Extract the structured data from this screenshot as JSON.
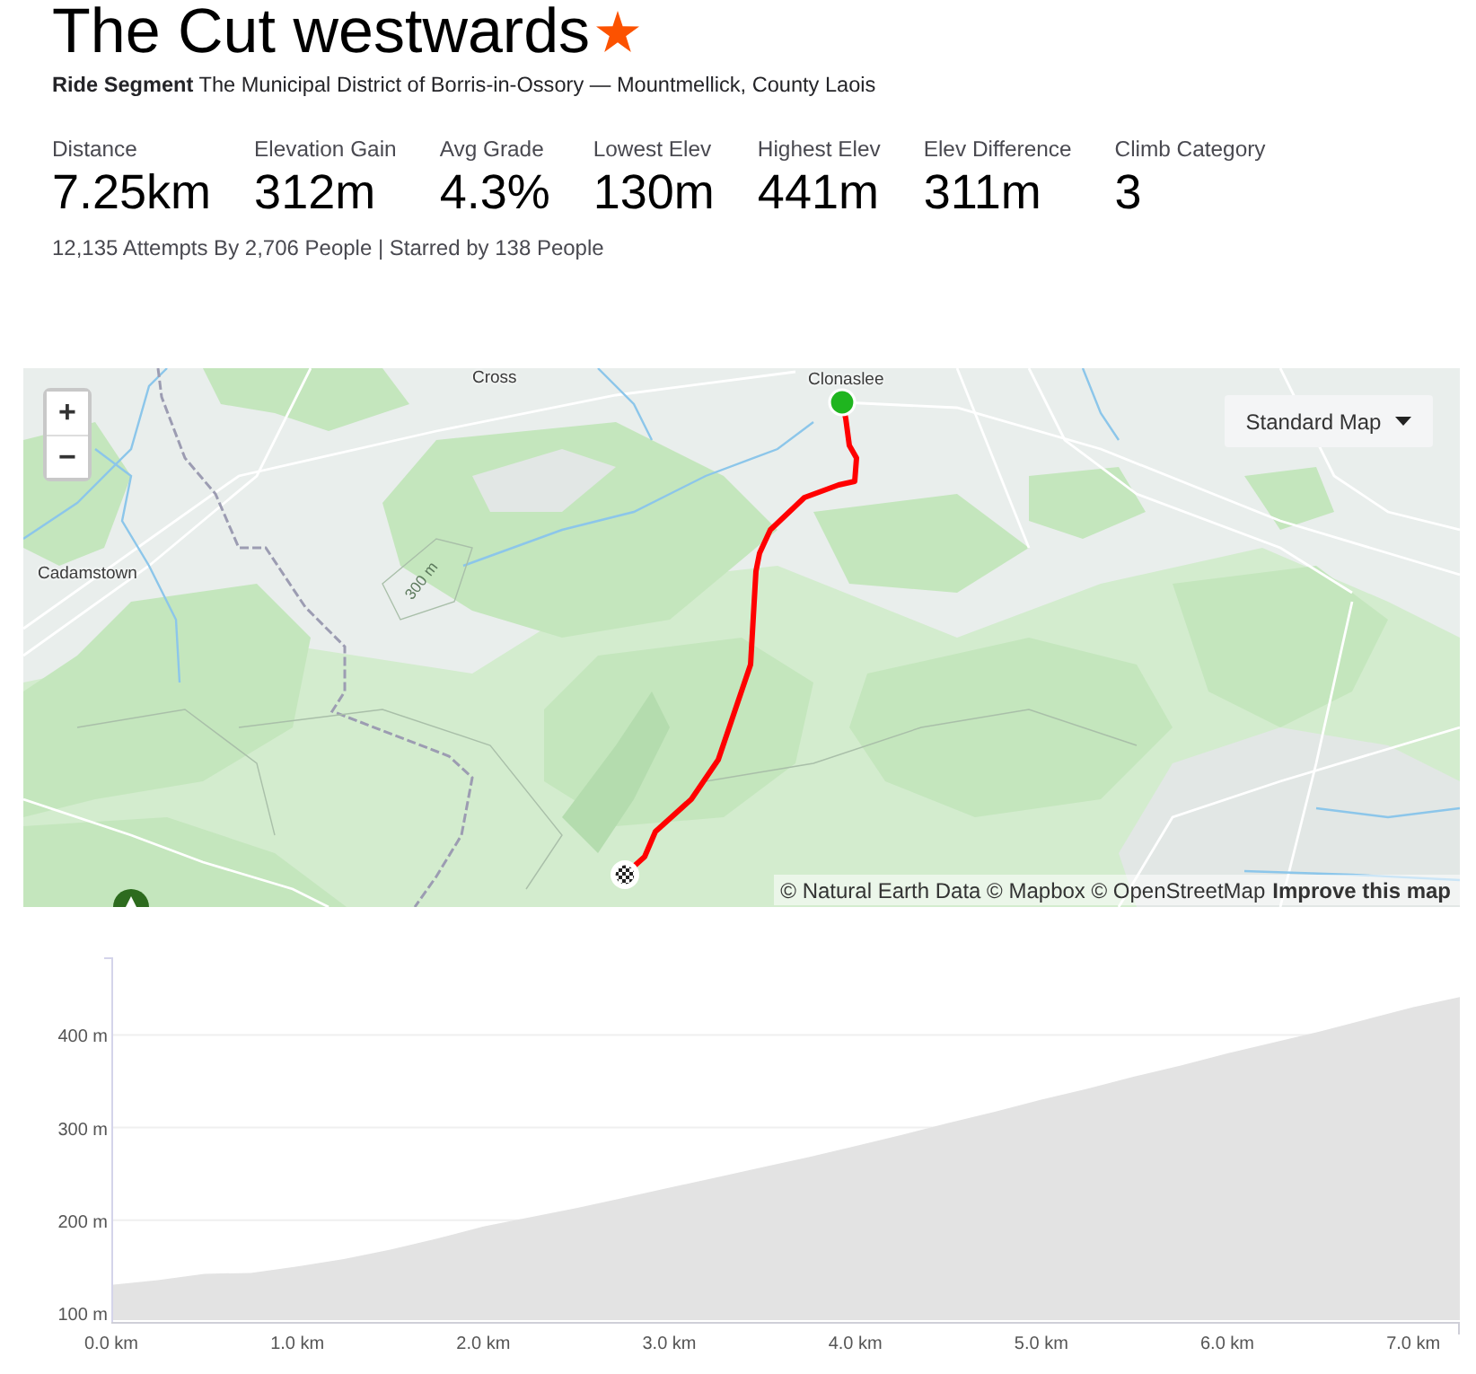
{
  "segment": {
    "title": "The Cut westwards",
    "starred": true,
    "subtitle": "**Ride Segment** The Municipal District of Borris-in-Ossory — Mountmellick, County Laois"
  },
  "stats": [
    {
      "label": "Distance",
      "value": "7.25km"
    },
    {
      "label": "Elevation Gain",
      "value": "312m"
    },
    {
      "label": "Avg Grade",
      "value": "4.3%"
    },
    {
      "label": "Lowest Elev",
      "value": "130m"
    },
    {
      "label": "Highest Elev",
      "value": "441m"
    },
    {
      "label": "Elev Difference",
      "value": "311m"
    },
    {
      "label": "Climb Category",
      "value": "3"
    }
  ],
  "summary": "12,135 Attempts By 2,706 People | Starred by 138 People",
  "map": {
    "place_labels": [
      {
        "text": "Cross",
        "kind": "place"
      },
      {
        "text": "Clonaslee",
        "kind": "place"
      },
      {
        "text": "Cadamstown",
        "kind": "place"
      },
      {
        "text": "300 m",
        "kind": "contour"
      }
    ],
    "zoom_controls": [
      "+",
      "−"
    ],
    "style_selector": "Standard Map",
    "attribution": "© Natural Earth Data © Mapbox © OpenStreetMap",
    "improve_link": "Improve this map"
  },
  "elevation_profile": {
    "chart_data": {
      "type": "area",
      "x": [
        0,
        0.25,
        0.5,
        0.75,
        1,
        1.25,
        1.5,
        1.75,
        2,
        2.25,
        2.5,
        2.75,
        3,
        3.25,
        3.5,
        3.75,
        4,
        4.25,
        4.5,
        4.75,
        5,
        5.25,
        5.5,
        5.75,
        6,
        6.25,
        6.5,
        6.75,
        7,
        7.25
      ],
      "series": [
        {
          "color": "#e3e3e3",
          "values": [
            130,
            135,
            142,
            143,
            150,
            158,
            168,
            180,
            193,
            203,
            213,
            224,
            235,
            246,
            257,
            268,
            280,
            292,
            305,
            317,
            330,
            342,
            355,
            367,
            380,
            392,
            404,
            417,
            430,
            441
          ]
        }
      ],
      "xlim": [
        0,
        7.25
      ],
      "ylim": [
        92,
        480
      ],
      "xticks": [
        {
          "value": 0,
          "label": "0.0 km"
        },
        {
          "value": 1,
          "label": "1.0 km"
        },
        {
          "value": 2,
          "label": "2.0 km"
        },
        {
          "value": 3,
          "label": "3.0 km"
        },
        {
          "value": 4,
          "label": "4.0 km"
        },
        {
          "value": 5,
          "label": "5.0 km"
        },
        {
          "value": 6,
          "label": "6.0 km"
        },
        {
          "value": 7,
          "label": "7.0 km"
        }
      ],
      "yticks": [
        {
          "value": 100,
          "label": "100 m"
        },
        {
          "value": 200,
          "label": "200 m"
        },
        {
          "value": 300,
          "label": "300 m"
        },
        {
          "value": 400,
          "label": "400 m"
        }
      ],
      "grid": true
    }
  }
}
